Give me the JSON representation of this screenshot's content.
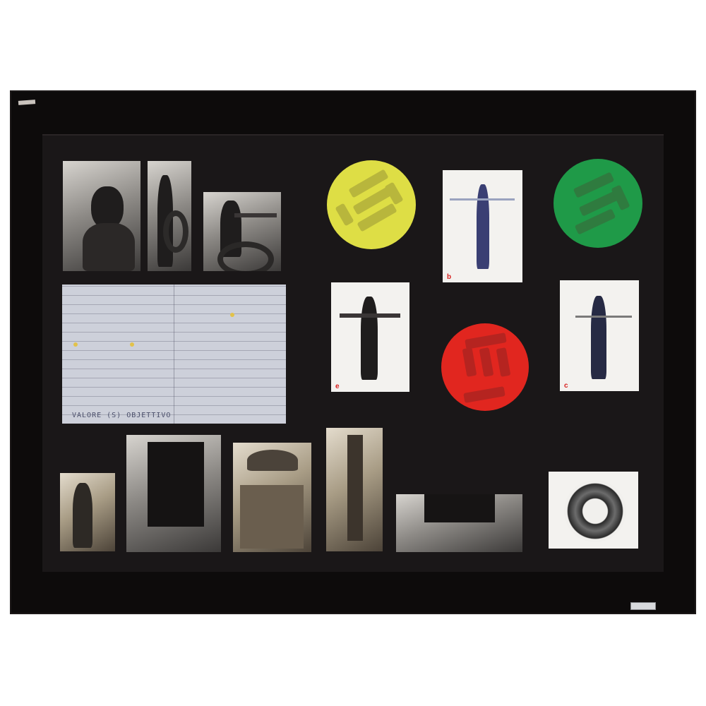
{
  "artwork": {
    "panel_letters": {
      "b": "b",
      "e": "e",
      "c": "c"
    },
    "note_bottom_text": "VALORE (S) OBJETTIVO",
    "signature": "",
    "plaque": ""
  },
  "colors": {
    "frame": "#0d0b0b",
    "panel": "#161415",
    "yellow_disc": "#dede45",
    "green_disc": "#1f9a48",
    "red_disc": "#e1261f",
    "letter_red": "#d8201f"
  },
  "icons": [
    "yellow-disc",
    "green-disc",
    "red-disc",
    "tyre-ring"
  ]
}
